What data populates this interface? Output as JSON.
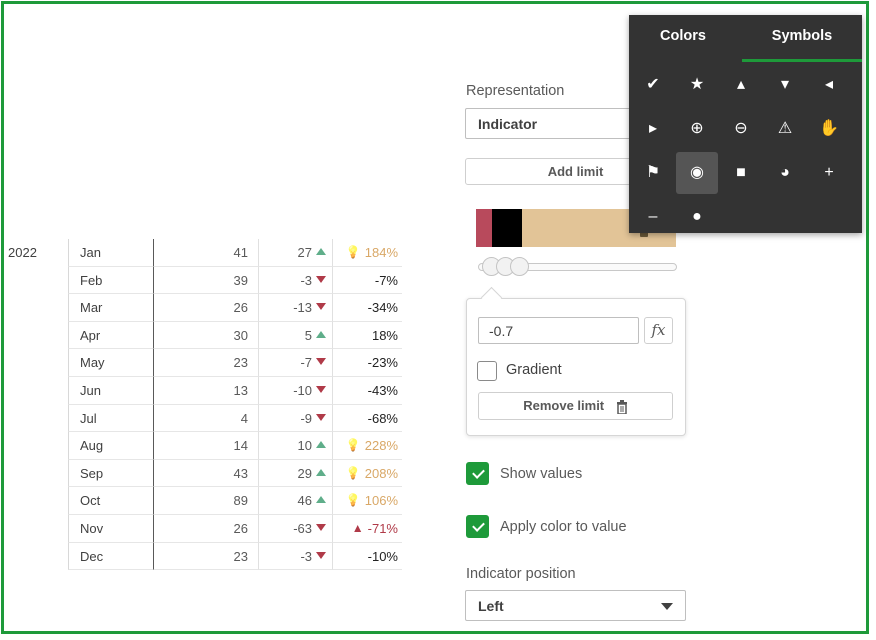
{
  "table": {
    "year": "2022",
    "rows": [
      {
        "month": "Jan",
        "v1": "41",
        "v2": "27",
        "trend": "up",
        "pct": "184%",
        "icon": "bulb",
        "pct_color": "#d9a867"
      },
      {
        "month": "Feb",
        "v1": "39",
        "v2": "-3",
        "trend": "down",
        "pct": "-7%",
        "icon": "",
        "pct_color": "#222222"
      },
      {
        "month": "Mar",
        "v1": "26",
        "v2": "-13",
        "trend": "down",
        "pct": "-34%",
        "icon": "",
        "pct_color": "#222222"
      },
      {
        "month": "Apr",
        "v1": "30",
        "v2": "5",
        "trend": "up",
        "pct": "18%",
        "icon": "",
        "pct_color": "#222222"
      },
      {
        "month": "May",
        "v1": "23",
        "v2": "-7",
        "trend": "down",
        "pct": "-23%",
        "icon": "",
        "pct_color": "#222222"
      },
      {
        "month": "Jun",
        "v1": "13",
        "v2": "-10",
        "trend": "down",
        "pct": "-43%",
        "icon": "",
        "pct_color": "#222222"
      },
      {
        "month": "Jul",
        "v1": "4",
        "v2": "-9",
        "trend": "down",
        "pct": "-68%",
        "icon": "",
        "pct_color": "#222222"
      },
      {
        "month": "Aug",
        "v1": "14",
        "v2": "10",
        "trend": "up",
        "pct": "228%",
        "icon": "bulb",
        "pct_color": "#d9a867"
      },
      {
        "month": "Sep",
        "v1": "43",
        "v2": "29",
        "trend": "up",
        "pct": "208%",
        "icon": "bulb",
        "pct_color": "#d9a867"
      },
      {
        "month": "Oct",
        "v1": "89",
        "v2": "46",
        "trend": "up",
        "pct": "106%",
        "icon": "bulb",
        "pct_color": "#d9a867"
      },
      {
        "month": "Nov",
        "v1": "26",
        "v2": "-63",
        "trend": "down",
        "pct": "-71%",
        "icon": "warning",
        "pct_color": "#b03a48"
      },
      {
        "month": "Dec",
        "v1": "23",
        "v2": "-3",
        "trend": "down",
        "pct": "-10%",
        "icon": "",
        "pct_color": "#222222"
      }
    ]
  },
  "panel": {
    "representation_label": "Representation",
    "representation_value": "Indicator",
    "add_limit_label": "Add limit",
    "limit_value": "-0.7",
    "fx_label": "fx",
    "gradient_label": "Gradient",
    "remove_limit_label": "Remove limit",
    "show_values_label": "Show values",
    "apply_color_label": "Apply color to value",
    "indicator_position_label": "Indicator position",
    "indicator_position_value": "Left",
    "limit_colors": [
      "#b84a5c",
      "#000000",
      "#e2c497"
    ]
  },
  "symbols_panel": {
    "tabs": [
      "Colors",
      "Symbols"
    ],
    "active_tab": "Symbols",
    "symbols": [
      "check-icon",
      "star-icon",
      "caret-up-icon",
      "caret-down-icon",
      "caret-left-icon",
      "caret-right-icon",
      "plus-circle-icon",
      "minus-circle-icon",
      "warning-icon",
      "hand-icon",
      "flag-icon",
      "lightbulb-icon",
      "square-icon",
      "pie-icon",
      "plus-icon",
      "minus-icon",
      "circle-icon"
    ],
    "selected_symbol": "lightbulb-icon"
  },
  "colors": {
    "accent": "#1e9a3a",
    "up": "#5fae8a",
    "down": "#b03a48",
    "highlight": "#d9a867"
  }
}
